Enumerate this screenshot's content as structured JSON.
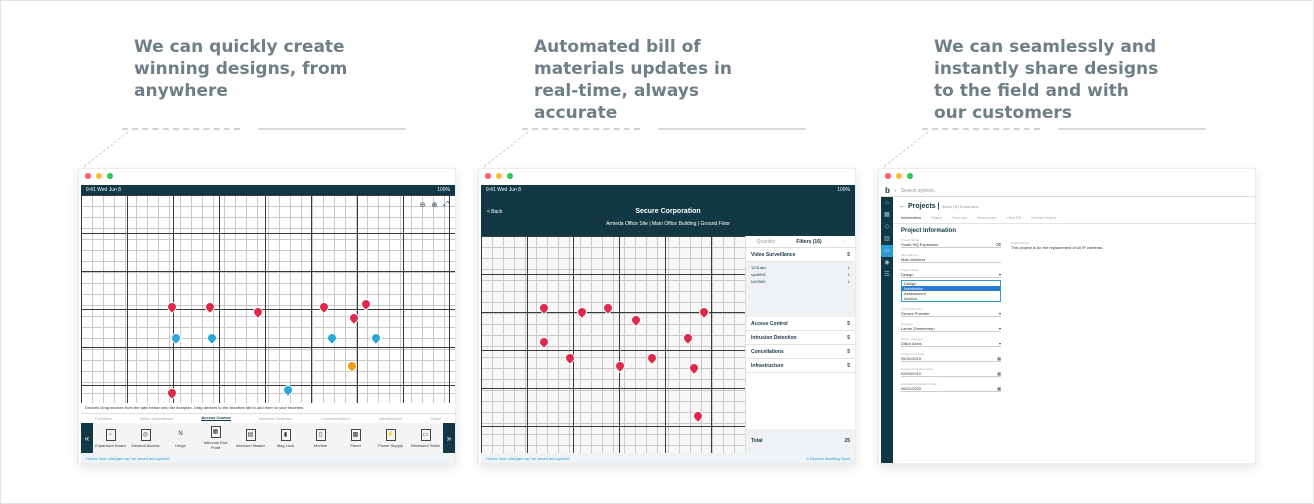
{
  "columns": [
    {
      "heading": "We can quickly create winning designs, from anywhere",
      "app": {
        "status_time": "9:41   Wed Jun 8",
        "status_right": "100%",
        "helper_text": "Devices Drag devices from the tabs below onto the floorplan. Drag devices to the favorites tab to add them to your favorites.",
        "tabs": [
          "Favorites",
          "Video Surveillance",
          "Access Control",
          "Intrusion Detection",
          "Communications",
          "Infrastructure",
          "Other"
        ],
        "active_tab": "Access Control",
        "devices": [
          "Expansion Board",
          "General Access",
          "Hinge",
          "Intercom End Point",
          "Intercom Master",
          "Mag Lock",
          "Mortise",
          "Panel",
          "Power Supply",
          "Recessed Strike"
        ],
        "footer": "Online Your changes can be saved and synced"
      }
    },
    {
      "heading": "Automated bill of materials updates in real-time, always accurate",
      "app": {
        "status_time": "9:41   Wed Jun 8",
        "status_right": "100%",
        "back_label": "< Back",
        "title": "Secure Corporation",
        "breadcrumb": "Armeda Office Site  |  Main Office Building  |  Ground Floor",
        "panel_tabs": [
          "Quantity",
          "Filters (16)"
        ],
        "categories": [
          {
            "name": "Video Surveillance",
            "count": "5"
          },
          {
            "name": "Access Control",
            "count": "5"
          },
          {
            "name": "Intrusion Detection",
            "count": "5"
          },
          {
            "name": "Concellations",
            "count": "5"
          },
          {
            "name": "Infrastructure",
            "count": "5"
          }
        ],
        "sub_items": [
          {
            "name": "1231abc",
            "count": "1"
          },
          {
            "name": "xyz8892",
            "count": "1"
          },
          {
            "name": "NV0565",
            "count": "1"
          }
        ],
        "total_label": "Total",
        "total_value": "25",
        "footer_left": "Online Your changes can be saved and synced",
        "footer_right": "6 Devices Awaiting Sync"
      }
    },
    {
      "heading": "We can seamlessly and instantly share designs to the field and with our customers",
      "app": {
        "search_placeholder": "Search system...",
        "page_title": "Projects",
        "page_sub": "South HQ Expansion",
        "tabs": [
          "Information",
          "Status",
          "Part List",
          "Resources",
          "View DS",
          "Delete Project"
        ],
        "section_title": "Project Information",
        "fields": [
          {
            "label": "Project Name",
            "value": "South HQ Expansion"
          },
          {
            "label": "Site Address",
            "value": "Main Address"
          },
          {
            "label": "Project Stage",
            "value": "Design"
          }
        ],
        "stage_options": [
          "Design",
          "Installation",
          "Assessment",
          "Archive"
        ],
        "fields2": [
          {
            "label": "Vertical Provider",
            "value": "Secure Provider"
          },
          {
            "label": "Designer",
            "value": "Laurie Zimmerman"
          },
          {
            "label": "Project Manager",
            "value": "Dillon Akins"
          },
          {
            "label": "Project Start Date",
            "value": "05/31/2019"
          },
          {
            "label": "Design Completion Date",
            "value": "02/03/2019"
          },
          {
            "label": "Estimated Installation Date",
            "value": "06/21/2020"
          }
        ],
        "description_label": "Project Notes",
        "description": "This project is for the replacement of all IP cameras."
      }
    }
  ]
}
